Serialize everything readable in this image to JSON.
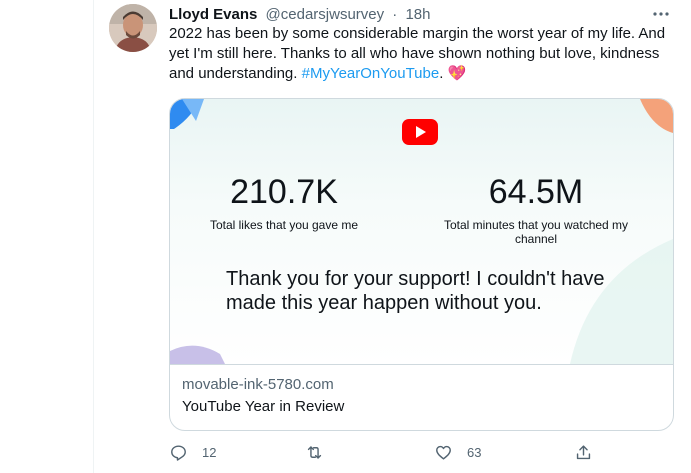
{
  "tweet": {
    "display_name": "Lloyd Evans",
    "handle": "@cedarsjwsurvey",
    "separator": "·",
    "time": "18h",
    "text_part1": "2022 has been by some considerable margin the worst year of my life. And yet I'm still here. Thanks to all who have shown nothing but love, kindness and understanding. ",
    "hashtag": "#MyYearOnYouTube",
    "text_part2": ". ",
    "emoji": "💖"
  },
  "card": {
    "stat1_value": "210.7K",
    "stat1_label": "Total likes that you gave me",
    "stat2_value": "64.5M",
    "stat2_label": "Total minutes that you watched my channel",
    "thanks_text": "Thank you for your support! I couldn't have made this year happen without you.",
    "domain": "movable-ink-5780.com",
    "title": "YouTube Year in Review"
  },
  "actions": {
    "reply_count": "12",
    "retweet_count": "",
    "like_count": "63"
  },
  "icons": [
    "more-icon",
    "reply-icon",
    "retweet-icon",
    "like-icon",
    "share-icon",
    "youtube-logo-icon"
  ],
  "colors": {
    "accent": "#1d9bf0",
    "text_primary": "#0f1419",
    "text_secondary": "#536471",
    "youtube_red": "#ff0000",
    "heart": "#e0245e"
  }
}
